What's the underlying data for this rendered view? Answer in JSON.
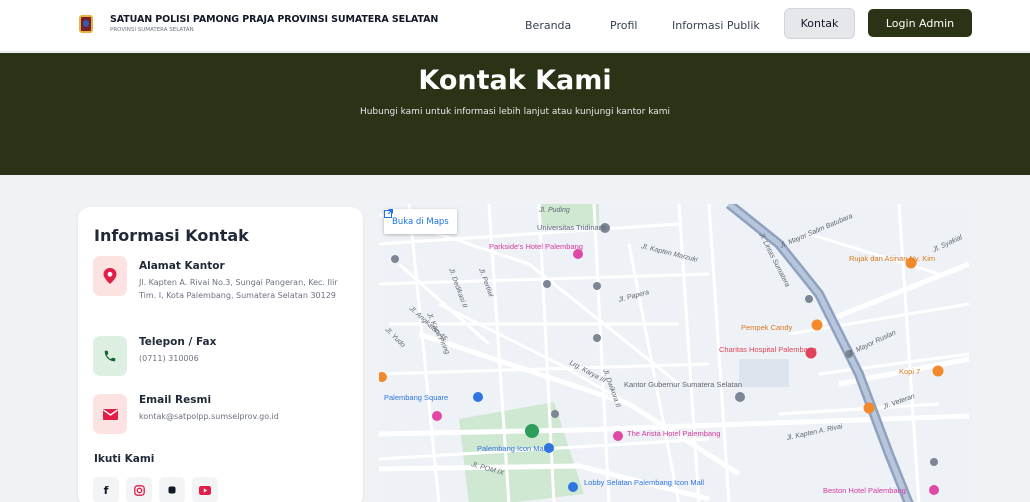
{
  "header": {
    "title": "SATUAN POLISI PAMONG PRAJA PROVINSI SUMATERA SELATAN",
    "subtitle": "PROVINSI SUMATERA SELATAN",
    "nav": {
      "beranda": "Beranda",
      "profil": "Profil",
      "informasi_publik": "Informasi Publik",
      "kontak": "Kontak",
      "login": "Login Admin"
    }
  },
  "hero": {
    "title": "Kontak Kami",
    "subtitle": "Hubungi kami untuk informasi lebih lanjut atau kunjungi kantor kami"
  },
  "contact": {
    "title": "Informasi Kontak",
    "address": {
      "label": "Alamat Kantor",
      "value": "Jl. Kapten A. Rivai No.3, Sungai Pangeran, Kec. Ilir Tim. I, Kota Palembang, Sumatera Selatan 30129"
    },
    "phone": {
      "label": "Telepon / Fax",
      "value": "(0711) 310006"
    },
    "email": {
      "label": "Email Resmi",
      "value": "kontak@satpolpp.sumselprov.go.id"
    },
    "follow_title": "Ikuti Kami",
    "socials": [
      "facebook-icon",
      "instagram-icon",
      "tiktok-icon",
      "youtube-icon"
    ]
  },
  "map": {
    "open_maps_label": "Buka di Maps",
    "streets": [
      "Jl. Puding",
      "Jl. Kapten Marzuki",
      "Jl. Mayor Salim Batubara",
      "Jl. Syakial",
      "Jl. Dedikasi II",
      "Jl. Pertiwi",
      "Jl. Papera",
      "Jl. Lintas Sumatera",
      "Jl. Kaca Piring",
      "Jl. Angkatan 45",
      "Jl. Yudo",
      "Jl. Mayor Ruslan",
      "Jl. Veteran",
      "Lrg. Karya III",
      "Jl. Dwikora II",
      "Jl. Kapten A. Rivai",
      "Jl. POM IX"
    ],
    "places": [
      "Universitas Tridinanti",
      "Parkside's Hotel Palembang",
      "Rujak dan Asinan Ny. Kim",
      "Pempek Candy",
      "Charitas Hospital Palembang",
      "Kopi 7",
      "Palembang Square",
      "Kantor Gubernur Sumatera Selatan",
      "The Arista Hotel Palembang",
      "Palembang Icon Mall",
      "Lobby Selatan Palembang Icon Mall",
      "Beston Hotel Palembang"
    ]
  },
  "colors": {
    "brand_dark": "#2b3316",
    "accent_red": "#e11d48",
    "accent_green": "#166534"
  }
}
